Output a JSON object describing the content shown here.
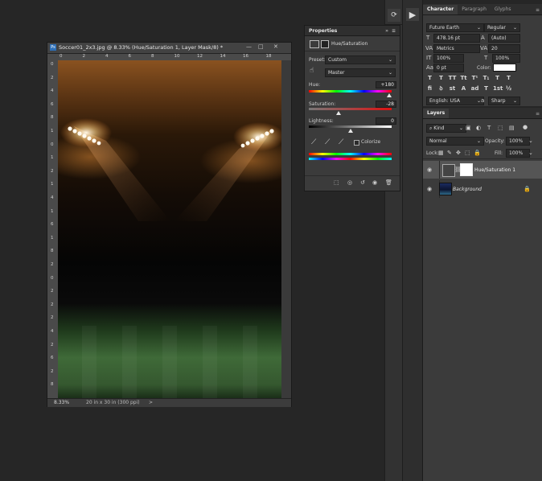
{
  "document": {
    "tab_title": "Soccer01_2x3.jpg @ 8.33% (Hue/Saturation 1, Layer Mask/8) *",
    "ruler_top": [
      "0",
      "2",
      "4",
      "6",
      "8",
      "10",
      "12",
      "14",
      "16",
      "18"
    ],
    "ruler_left": [
      "0",
      "2",
      "4",
      "6",
      "8",
      "1",
      "0",
      "1",
      "2",
      "1",
      "4",
      "1",
      "6",
      "1",
      "8",
      "2",
      "0",
      "2",
      "2",
      "2",
      "4",
      "2",
      "6",
      "2",
      "8"
    ],
    "zoom": "8.33%",
    "doc_info": "20 in x 30 in (300 ppi)",
    "win_min": "—",
    "win_max": "□",
    "win_close": "✕"
  },
  "properties": {
    "title": "Properties",
    "adjustment": "Hue/Saturation",
    "preset_label": "Preset:",
    "preset_value": "Custom",
    "channel_value": "Master",
    "hue_label": "Hue:",
    "hue_value": "+180",
    "hue_frac": 1.0,
    "saturation_label": "Saturation:",
    "saturation_value": "-28",
    "saturation_frac": 0.36,
    "lightness_label": "Lightness:",
    "lightness_value": "0",
    "lightness_frac": 0.5,
    "colorize_label": "Colorize"
  },
  "character": {
    "tabs": [
      "Character",
      "Paragraph",
      "Glyphs"
    ],
    "font_family": "Future Earth",
    "font_style": "Regular",
    "font_size": "478.16 pt",
    "leading": "(Auto)",
    "kerning": "Metrics",
    "tracking": "20",
    "vertical_scale": "100%",
    "horizontal_scale": "100%",
    "baseline_shift": "0 pt",
    "color_label": "Color:",
    "language": "English: USA",
    "antialias": "Sharp",
    "style_buttons": [
      "T",
      "T",
      "TT",
      "Tt",
      "T¹",
      "T₁",
      "T",
      "T"
    ],
    "opentype_buttons": [
      "fi",
      "ꝺ",
      "st",
      "A",
      "ad",
      "T",
      "1st",
      "½"
    ]
  },
  "layers": {
    "tab": "Layers",
    "filter": "Kind",
    "blend_mode": "Normal",
    "opacity_label": "Opacity:",
    "opacity": "100%",
    "lock_label": "Lock:",
    "fill_label": "Fill:",
    "fill": "100%",
    "items": [
      {
        "name": "Hue/Saturation 1"
      },
      {
        "name": "Background"
      }
    ]
  },
  "colors": {
    "accent_blue": "#2d8ceb"
  }
}
